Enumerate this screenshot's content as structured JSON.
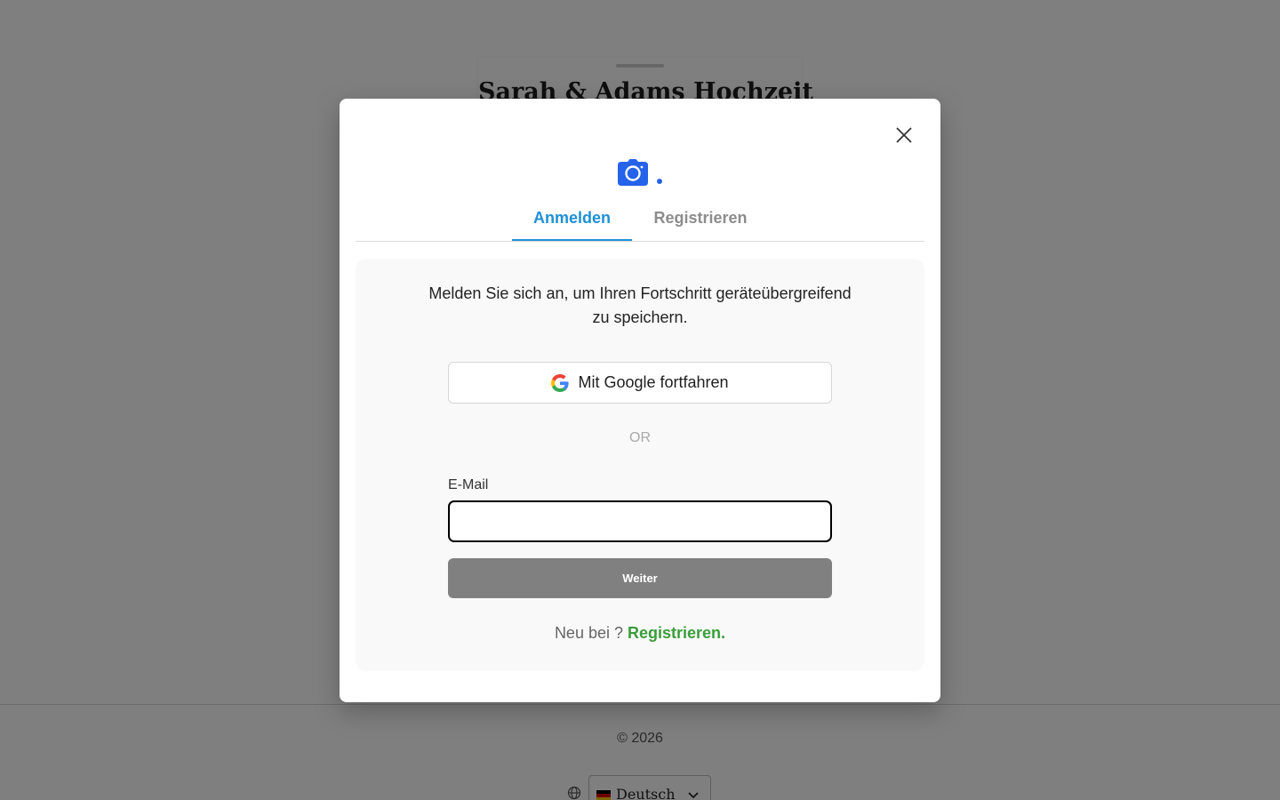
{
  "background": {
    "title": "Sarah & Adams Hochzeit",
    "copyright": "© 2026",
    "language": {
      "selected": "Deutsch",
      "flag_icon": "germany-flag-icon"
    }
  },
  "modal": {
    "logo_icon": "camera-icon",
    "accent_color": "#2563eb",
    "tabs": [
      {
        "label": "Anmelden",
        "active": true
      },
      {
        "label": "Registrieren",
        "active": false
      }
    ],
    "description": "Melden Sie sich an, um Ihren Fortschritt geräteübergreifend zu speichern.",
    "google_button": "Mit Google fortfahren",
    "or_divider": "OR",
    "email": {
      "label": "E-Mail",
      "value": "",
      "placeholder": ""
    },
    "continue_button": "Weiter",
    "signup": {
      "prefix": "Neu bei ?",
      "link": "Registrieren."
    }
  }
}
